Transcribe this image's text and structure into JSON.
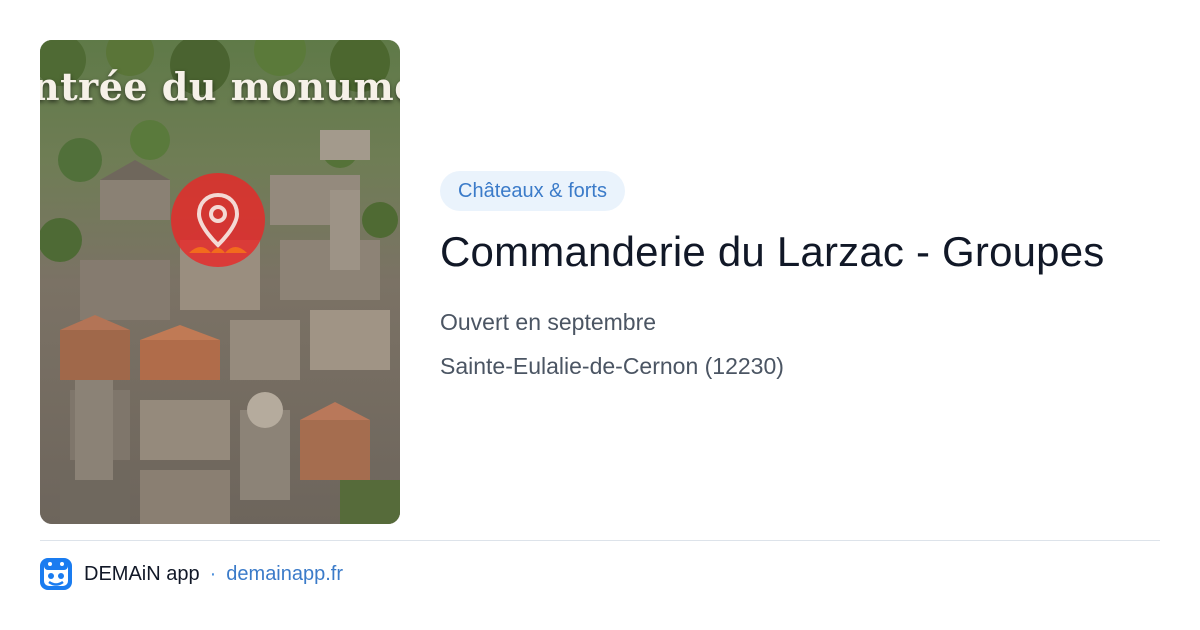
{
  "card": {
    "image_alt": "Vue aérienne de la Commanderie du Larzac",
    "overlay_text": "ntrée du monume",
    "pin_icon": "map-pin-icon",
    "pin_color": "#e82828",
    "category": "Châteaux & forts",
    "title": "Commanderie du Larzac - Groupes",
    "hours": "Ouvert en septembre",
    "location": "Sainte-Eulalie-de-Cernon (12230)"
  },
  "footer": {
    "app_icon": "demain-app-icon",
    "app_name": "DEMAiN app",
    "separator": "·",
    "domain": "demainapp.fr"
  },
  "colors": {
    "chip_bg": "#eaf3fc",
    "chip_text": "#3b7bc9",
    "title": "#111827",
    "meta": "#4b5563",
    "link": "#3b7bc9",
    "app_icon_bg": "#1a7cf0"
  }
}
